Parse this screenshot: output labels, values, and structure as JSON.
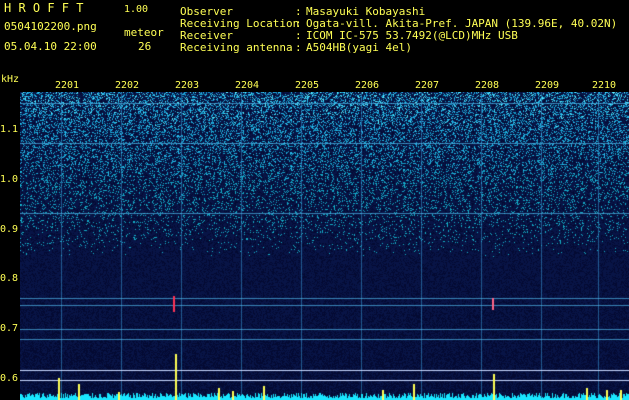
{
  "header": {
    "app_name": "H R O F F T",
    "version": "1.00",
    "filename": "0504102200.png",
    "meteor_label": "meteor",
    "datetime": "05.04.10 22:00",
    "meteor_count": "26"
  },
  "info": {
    "rows": [
      {
        "label": "Observer",
        "sep": ":",
        "value": "Masayuki Kobayashi"
      },
      {
        "label": "Receiving Location",
        "sep": ":",
        "value": "Ogata-vill. Akita-Pref. JAPAN (139.96E, 40.02N)"
      },
      {
        "label": "Receiver",
        "sep": ":",
        "value": "ICOM IC-575 53.7492(@LCD)MHz USB"
      },
      {
        "label": "Receiving antenna",
        "sep": ":",
        "value": "A504HB(yagi 4el)"
      }
    ]
  },
  "axes": {
    "y_unit": "kHz",
    "y_ticks": [
      "1.1",
      "1.0",
      "0.9",
      "0.8",
      "0.7",
      "0.6"
    ],
    "x_ticks": [
      "2201",
      "2202",
      "2203",
      "2204",
      "2205",
      "2206",
      "2207",
      "2208",
      "2209",
      "2210"
    ]
  },
  "colors": {
    "label_yellow": "#ffff55",
    "background": "#000000",
    "spectrum_blue": "#1a2ba0",
    "noise_cyan": "#19e6ff",
    "meteor_red": "#ff3355"
  }
}
